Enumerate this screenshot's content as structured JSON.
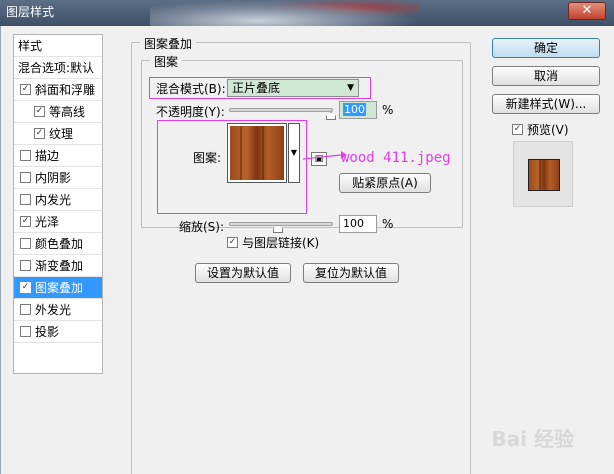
{
  "window": {
    "title": "图层样式",
    "close": "✕"
  },
  "style_list": {
    "header": "样式",
    "blend_defaults": "混合选项:默认",
    "items": [
      {
        "label": "斜面和浮雕",
        "checked": true,
        "indent": false,
        "selected": false
      },
      {
        "label": "等高线",
        "checked": true,
        "indent": true,
        "selected": false
      },
      {
        "label": "纹理",
        "checked": true,
        "indent": true,
        "selected": false
      },
      {
        "label": "描边",
        "checked": false,
        "indent": false,
        "selected": false
      },
      {
        "label": "内阴影",
        "checked": false,
        "indent": false,
        "selected": false
      },
      {
        "label": "内发光",
        "checked": false,
        "indent": false,
        "selected": false
      },
      {
        "label": "光泽",
        "checked": true,
        "indent": false,
        "selected": false
      },
      {
        "label": "颜色叠加",
        "checked": false,
        "indent": false,
        "selected": false
      },
      {
        "label": "渐变叠加",
        "checked": false,
        "indent": false,
        "selected": false
      },
      {
        "label": "图案叠加",
        "checked": true,
        "indent": false,
        "selected": true
      },
      {
        "label": "外发光",
        "checked": false,
        "indent": false,
        "selected": false
      },
      {
        "label": "投影",
        "checked": false,
        "indent": false,
        "selected": false
      }
    ]
  },
  "pattern_overlay": {
    "title": "图案叠加",
    "group_title": "图案",
    "blend_mode_label": "混合模式(B):",
    "blend_mode_value": "正片叠底",
    "opacity_label": "不透明度(Y):",
    "opacity_value": "100",
    "percent": "%",
    "pattern_label": "图案:",
    "annotation": "wood 411.jpeg",
    "snap_button": "贴紧原点(A)",
    "scale_label": "缩放(S):",
    "scale_value": "100",
    "link_label": "与图层链接(K)",
    "link_checked": true,
    "make_default": "设置为默认值",
    "reset_default": "复位为默认值"
  },
  "buttons": {
    "ok": "确定",
    "cancel": "取消",
    "new_style": "新建样式(W)...",
    "preview_label": "预览(V)",
    "preview_checked": true
  },
  "watermark": "Bai 经验"
}
